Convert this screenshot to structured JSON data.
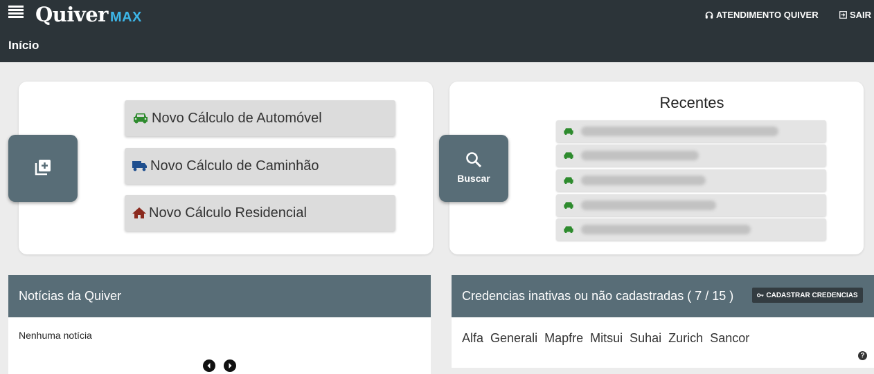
{
  "header": {
    "logo_main": "Quiver",
    "logo_sub": "MAX",
    "support_label": "ATENDIMENTO QUIVER",
    "logout_label": "SAIR",
    "page_title": "Início"
  },
  "quick_actions": {
    "new_icon": "add-box-icon",
    "items": [
      {
        "label": "Novo Cálculo de Automóvel",
        "icon": "car-icon",
        "color": "#2e8b2e"
      },
      {
        "label": "Novo Cálculo de Caminhão",
        "icon": "truck-icon",
        "color": "#1f4f8f"
      },
      {
        "label": "Novo Cálculo Residencial",
        "icon": "home-icon",
        "color": "#8b2a1e"
      }
    ]
  },
  "recent": {
    "title": "Recentes",
    "search_label": "Buscar",
    "rows": [
      {
        "icon": "car-icon",
        "text": "(blurred)"
      },
      {
        "icon": "car-icon",
        "text": "(blurred)"
      },
      {
        "icon": "car-icon",
        "text": "(blurred)"
      },
      {
        "icon": "car-icon",
        "text": "(blurred)"
      },
      {
        "icon": "car-icon",
        "text": "(blurred)"
      }
    ]
  },
  "news": {
    "title": "Notícias da Quiver",
    "empty_text": "Nenhuma notícia"
  },
  "credentials": {
    "title": "Credencias inativas ou não cadastradas ( 7 / 15 )",
    "register_button": "CADASTRAR CREDENCIAS",
    "insurers": [
      "Alfa",
      "Generali",
      "Mapfre",
      "Mitsui",
      "Suhai",
      "Zurich",
      "Sancor"
    ],
    "help": "?"
  },
  "colors": {
    "topbar": "#2c3439",
    "accent": "#586d77",
    "logo_accent": "#3db6e8",
    "car_green": "#2e8b2e"
  }
}
